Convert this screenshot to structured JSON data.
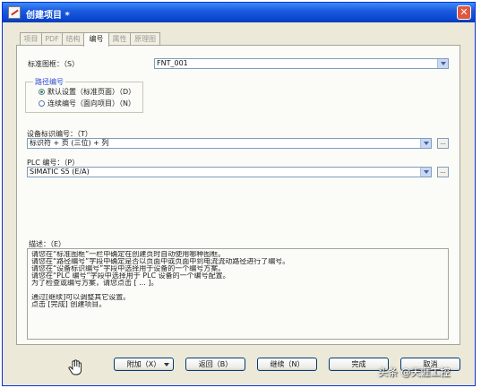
{
  "window": {
    "title": "创建项目 *"
  },
  "tabs": [
    "项目",
    "PDF",
    "结构",
    "编号",
    "属性",
    "原理图"
  ],
  "active_tab": "编号",
  "standard_form": {
    "label": "标准图框：（S）",
    "value": "FNT_001"
  },
  "path_numbering": {
    "title": "路径编号",
    "options": [
      "默认设置（标准页面）（D）",
      "连续编号（面向项目）（N）"
    ],
    "selected": 0
  },
  "device_id": {
    "label": "设备标识编号：（T）",
    "value": "标识符 + 页 (三位) + 列",
    "browse": "..."
  },
  "plc": {
    "label": "PLC 编号：（P）",
    "value": "SIMATIC S5 (E/A)",
    "browse": "..."
  },
  "description": {
    "label": "描述：（E）",
    "lines": [
      "请您在“标准图框”一栏中确定在创建页时自动使用哪种图框。",
      "请您在“路径编号”字段中确定是否以页面中或页面中到电流流动路径进行了编号。",
      "请您在“设备标识编号”字段中选择用于设备的一个编号方案。",
      "请您在“PLC 编号”字段中选择用于 PLC 设备的一个编号配置。",
      "为了检查或编号方案，请您点击 [ ... ]。",
      "",
      "通过[继续]可以调整其它设置。",
      "点击 [完成] 创建项目。"
    ]
  },
  "buttons": {
    "extra": "附加（X）",
    "back": "返回（B）",
    "next": "继续（N）",
    "finish": "完成",
    "cancel": "取消"
  },
  "watermark": "头条 @天涯工控"
}
